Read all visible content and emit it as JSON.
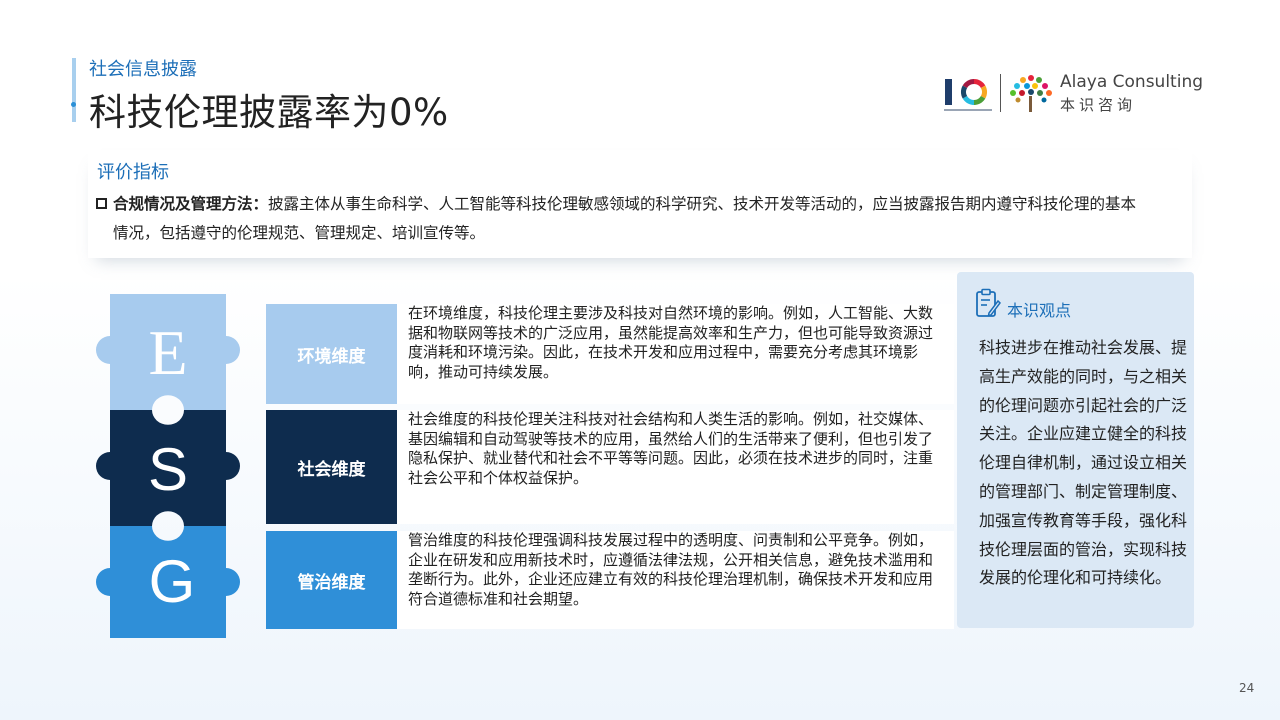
{
  "header": {
    "section_label": "社会信息披露",
    "title": "科技伦理披露率为0%"
  },
  "logo": {
    "anniversary_mark": "10",
    "company_en": "Alaya Consulting",
    "company_cn": "本识咨询"
  },
  "criteria": {
    "title": "评价指标",
    "item_label": "合规情况及管理方法：",
    "item_text_line1": "披露主体从事生命科学、人工智能等科技伦理敏感领域的科学研究、技术开发等活动的，应当披露报告期内遵守科技伦理的基本",
    "item_text_line2": "情况，包括遵守的伦理规范、管理规定、培训宣传等。"
  },
  "puzzle": {
    "letters": [
      "E",
      "S",
      "G"
    ],
    "colors": [
      "#a7cbee",
      "#0e2c4e",
      "#2f8fd8"
    ]
  },
  "dimensions": [
    {
      "label": "环境维度",
      "text": "在环境维度，科技伦理主要涉及科技对自然环境的影响。例如，人工智能、大数据和物联网等技术的广泛应用，虽然能提高效率和生产力，但也可能导致资源过度消耗和环境污染。因此，在技术开发和应用过程中，需要充分考虑其环境影响，推动可持续发展。"
    },
    {
      "label": "社会维度",
      "text": "社会维度的科技伦理关注科技对社会结构和人类生活的影响。例如，社交媒体、基因编辑和自动驾驶等技术的应用，虽然给人们的生活带来了便利，但也引发了隐私保护、就业替代和社会不平等等问题。因此，必须在技术进步的同时，注重社会公平和个体权益保护。"
    },
    {
      "label": "管治维度",
      "text": "管治维度的科技伦理强调科技发展过程中的透明度、问责制和公平竞争。例如，企业在研发和应用新技术时，应遵循法律法规，公开相关信息，避免技术滥用和垄断行为。此外，企业还应建立有效的科技伦理治理机制，确保技术开发和应用符合道德标准和社会期望。"
    }
  ],
  "opinion": {
    "icon": "clipboard-pen-icon",
    "title": "本识观点",
    "body": "科技进步在推动社会发展、提高生产效能的同时，与之相关的伦理问题亦引起社会的广泛关注。企业应建立健全的科技伦理自律机制，通过设立相关的管理部门、制定管理制度、加强宣传教育等手段，强化科技伦理层面的管治，实现科技发展的伦理化和可持续化。"
  },
  "page_number": "24"
}
